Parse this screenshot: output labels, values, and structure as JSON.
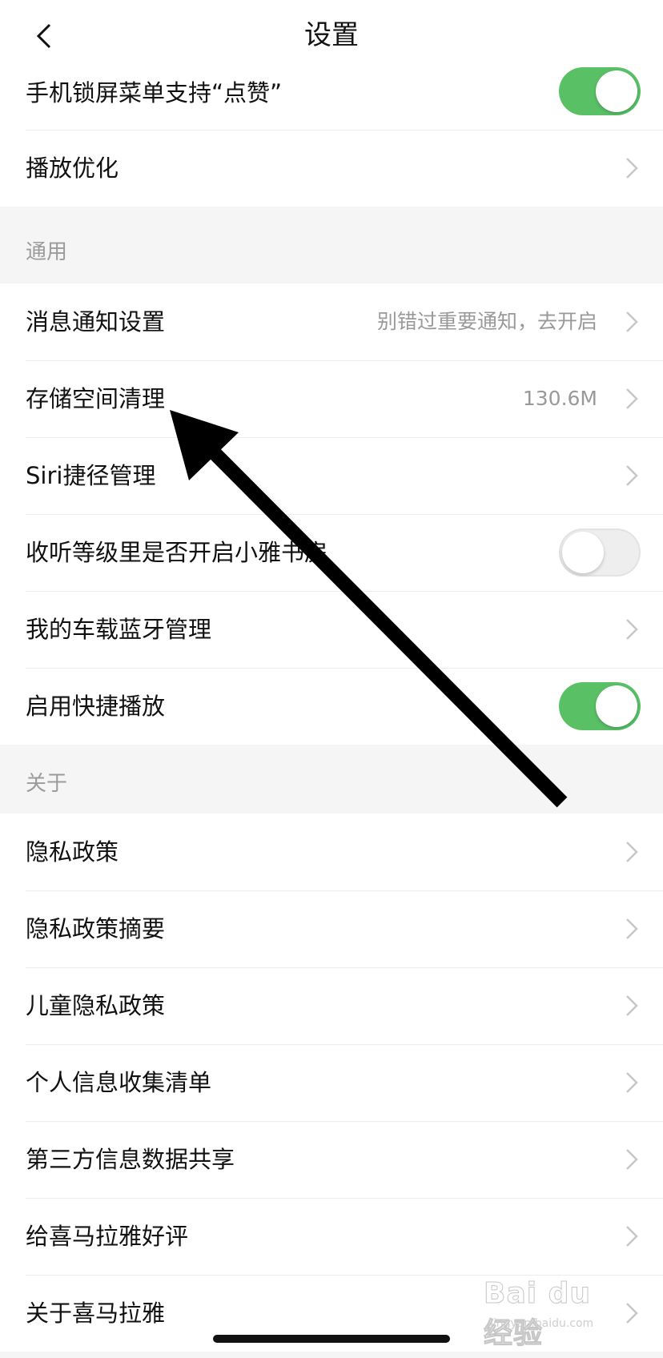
{
  "nav": {
    "title": "设置"
  },
  "group_top": {
    "items": [
      {
        "label": "手机锁屏菜单支持“点赞”",
        "switch": "on"
      },
      {
        "label": "播放优化"
      }
    ]
  },
  "section_general": {
    "title": "通用",
    "items": [
      {
        "label": "消息通知设置",
        "value": "别错过重要通知，去开启"
      },
      {
        "label": "存储空间清理",
        "value": "130.6M"
      },
      {
        "label": "Siri捷径管理"
      },
      {
        "label": "收听等级里是否开启小雅书房",
        "switch": "off"
      },
      {
        "label": "我的车载蓝牙管理"
      },
      {
        "label": "启用快捷播放",
        "switch": "on"
      }
    ]
  },
  "section_about": {
    "title": "关于",
    "items": [
      {
        "label": "隐私政策"
      },
      {
        "label": "隐私政策摘要"
      },
      {
        "label": "儿童隐私政策"
      },
      {
        "label": "个人信息收集清单"
      },
      {
        "label": "第三方信息数据共享"
      },
      {
        "label": "给喜马拉雅好评"
      },
      {
        "label": "关于喜马拉雅"
      }
    ]
  },
  "watermark": {
    "main": "Bai du 经验",
    "sub": "jingyan.baidu.com"
  },
  "colors": {
    "switch_on": "#5ac066",
    "secondary_text": "#999999",
    "section_bg": "#f5f5f5"
  }
}
